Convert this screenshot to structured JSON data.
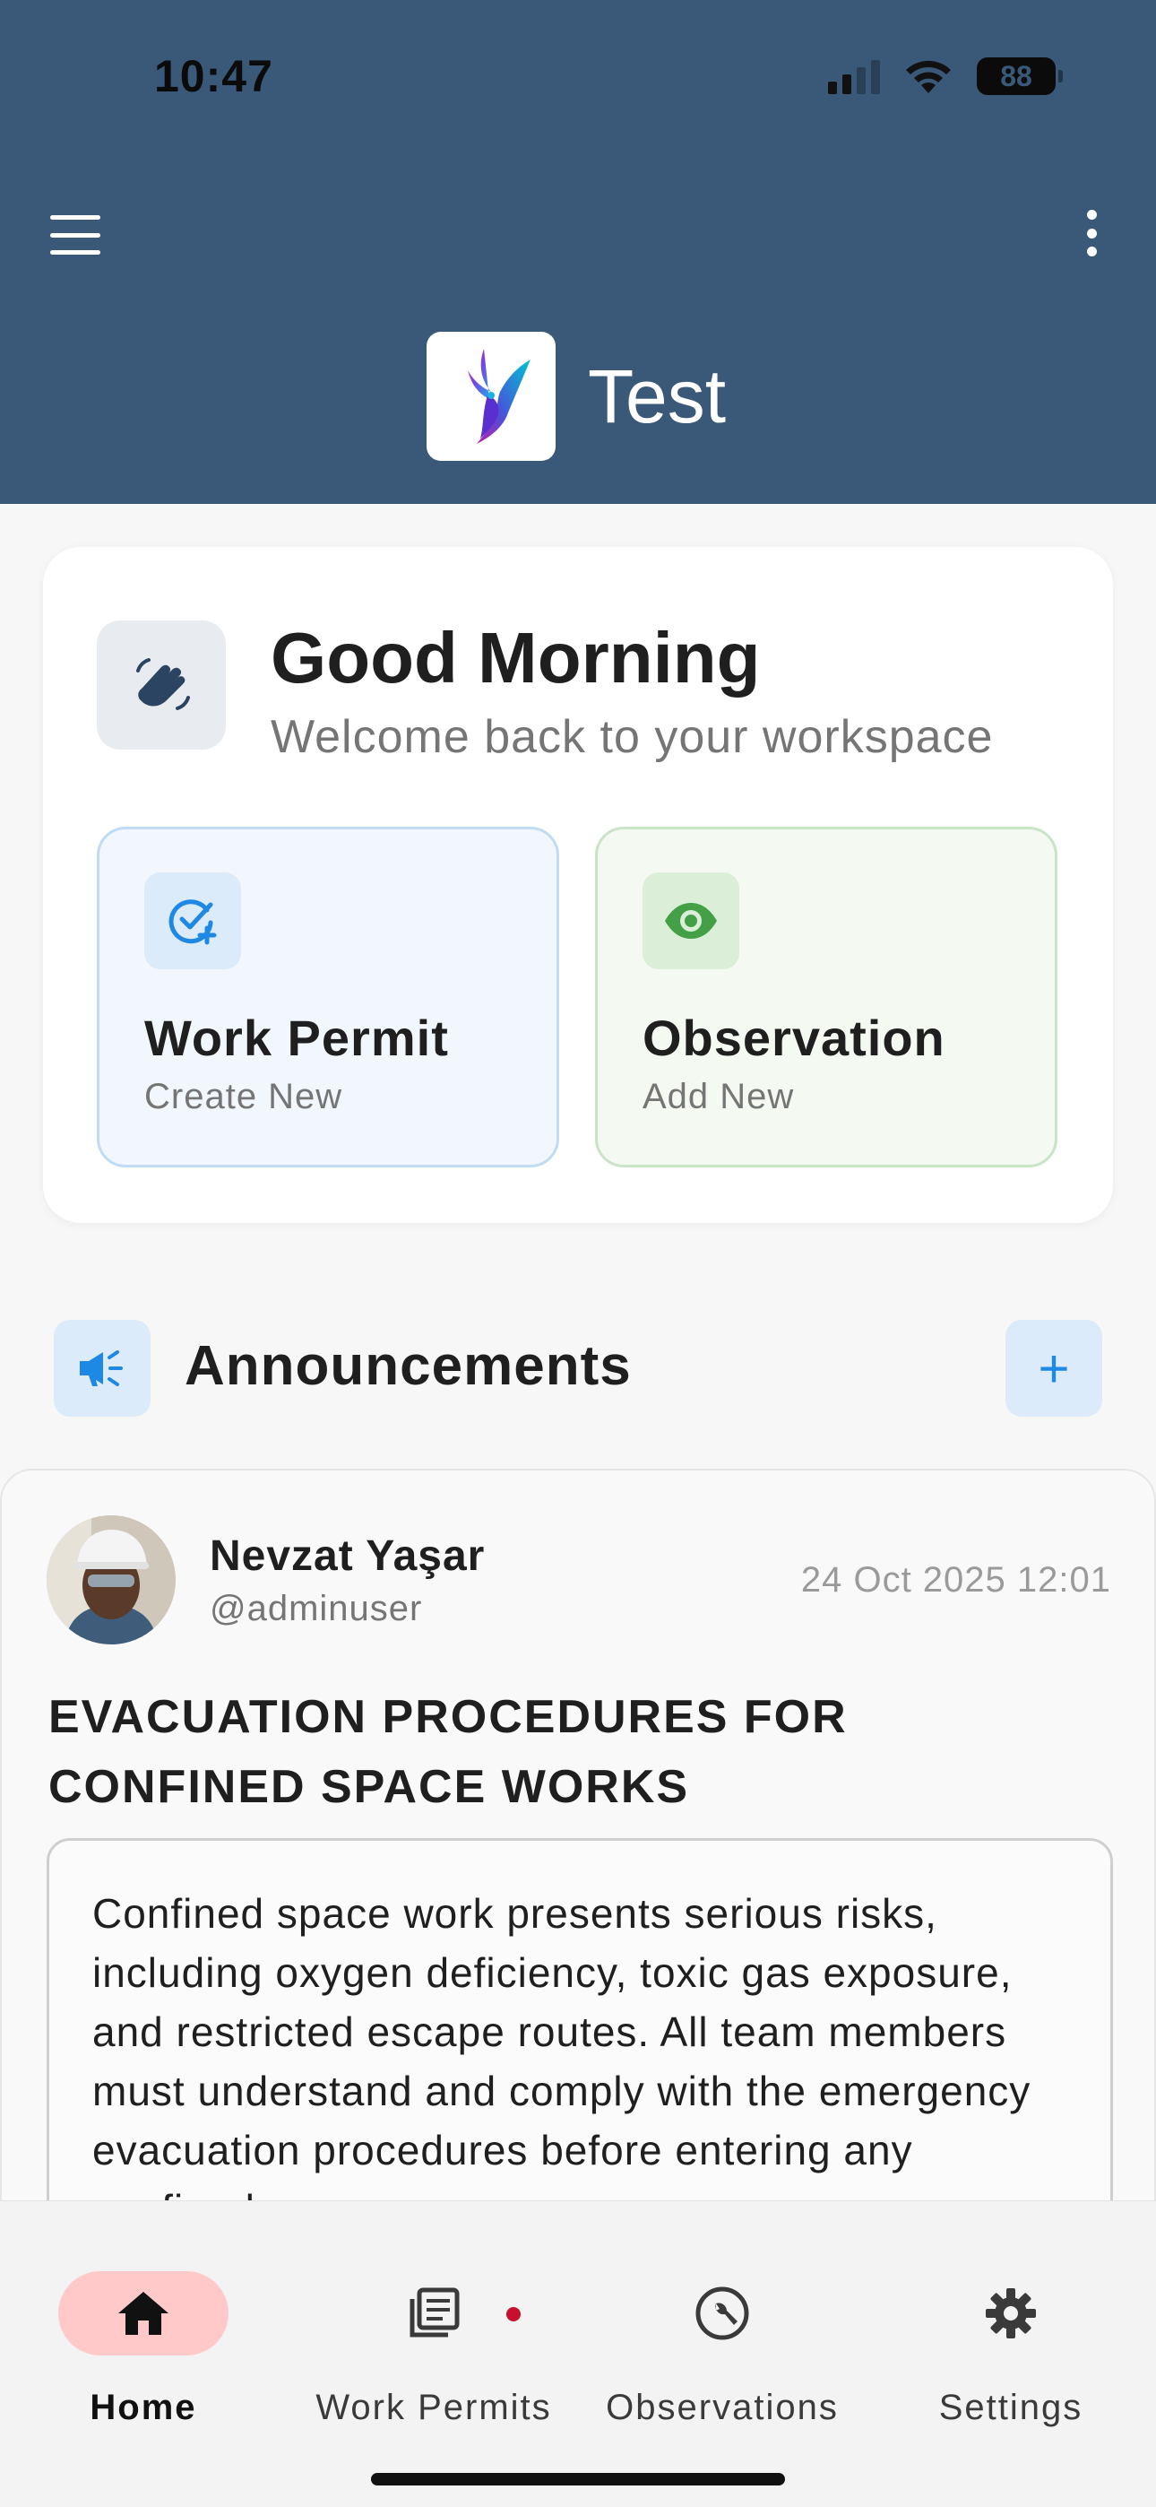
{
  "status_bar": {
    "time": "10:47",
    "battery": "88"
  },
  "header": {
    "app_title": "Test"
  },
  "greeting": {
    "title": "Good Morning",
    "subtitle": "Welcome back to your workspace"
  },
  "quick_actions": [
    {
      "title": "Work Permit",
      "subtitle": "Create New",
      "icon": "check-plus-icon",
      "color": "#1e88e5"
    },
    {
      "title": "Observation",
      "subtitle": "Add New",
      "icon": "eye-icon",
      "color": "#43a047"
    }
  ],
  "announcements": {
    "title": "Announcements",
    "add_label": "+",
    "posts": [
      {
        "author": "Nevzat Yaşar",
        "handle": "@adminuser",
        "date": "24 Oct 2025 12:01",
        "title": "EVACUATION PROCEDURES FOR CONFINED SPACE WORKS",
        "body": "Confined space work presents serious risks, including oxygen deficiency, toxic gas exposure, and restricted escape routes. All team members must understand and comply with the emergency evacuation procedures before entering any confined space."
      }
    ]
  },
  "bottom_nav": {
    "items": [
      {
        "label": "Home",
        "icon": "home-icon",
        "active": true
      },
      {
        "label": "Work Permits",
        "icon": "document-list-icon",
        "badge": true
      },
      {
        "label": "Observations",
        "icon": "wrench-circle-icon"
      },
      {
        "label": "Settings",
        "icon": "gear-icon"
      }
    ]
  },
  "colors": {
    "header": "#3a5878",
    "accent_blue": "#1e88e5",
    "accent_green": "#43a047",
    "active_tab": "#ffc9c9",
    "badge": "#c8102e"
  }
}
